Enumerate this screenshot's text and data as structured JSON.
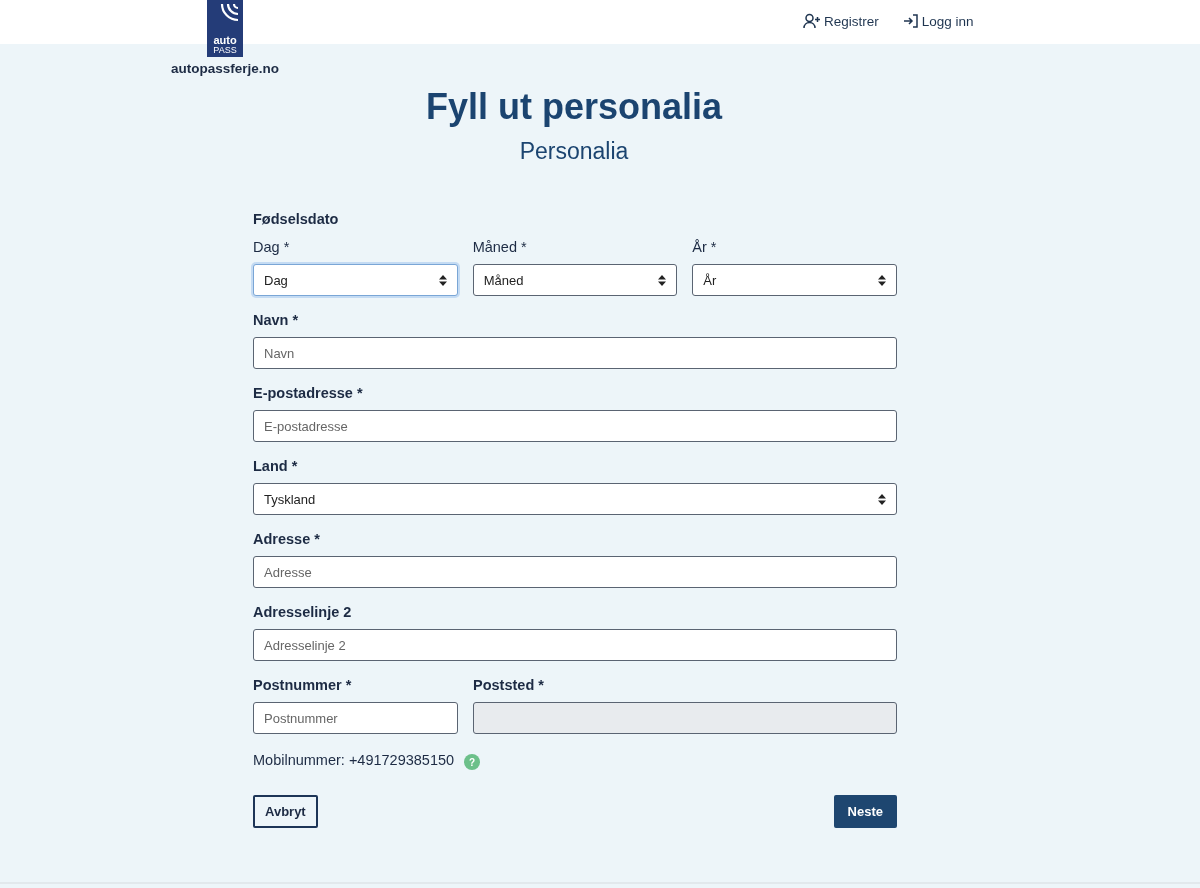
{
  "header": {
    "logo": {
      "line_1": "auto",
      "line_2": "PASS"
    },
    "site_name": "autopassferje.no",
    "nav": [
      {
        "label": "Registrer"
      },
      {
        "label": "Logg inn"
      }
    ]
  },
  "title": "Fyll ut personalia",
  "subtitle": "Personalia",
  "birthdate": {
    "legend": "Fødselsdato",
    "selects": [
      {
        "label": "Dag *",
        "value": "Dag",
        "focused": true
      },
      {
        "label": "Måned *",
        "value": "Måned",
        "focused": false
      },
      {
        "label": "År *",
        "value": "År",
        "focused": false
      }
    ]
  },
  "rows": [
    [
      {
        "label": "Navn *",
        "kind": "input",
        "placeholder": "Navn",
        "disabled": false
      }
    ],
    [
      {
        "label": "E-postadresse *",
        "kind": "input",
        "placeholder": "E-postadresse",
        "disabled": false
      }
    ],
    [
      {
        "label": "Land *",
        "kind": "select",
        "value": "Tyskland",
        "disabled": false
      }
    ],
    [
      {
        "label": "Adresse *",
        "kind": "input",
        "placeholder": "Adresse",
        "disabled": false
      }
    ],
    [
      {
        "label": "Adresselinje 2",
        "kind": "input",
        "placeholder": "Adresselinje 2",
        "disabled": false
      }
    ],
    [
      {
        "label": "Postnummer *",
        "kind": "input",
        "placeholder": "Postnummer",
        "disabled": false
      },
      {
        "label": "Poststed *",
        "kind": "input",
        "disabled": true
      }
    ]
  ],
  "mobile": {
    "text": "Mobilnummer: +491729385150",
    "help": "?"
  },
  "buttons": [
    {
      "label": "Avbryt",
      "kind": "secondary"
    },
    {
      "label": "Neste",
      "kind": "primary"
    }
  ]
}
